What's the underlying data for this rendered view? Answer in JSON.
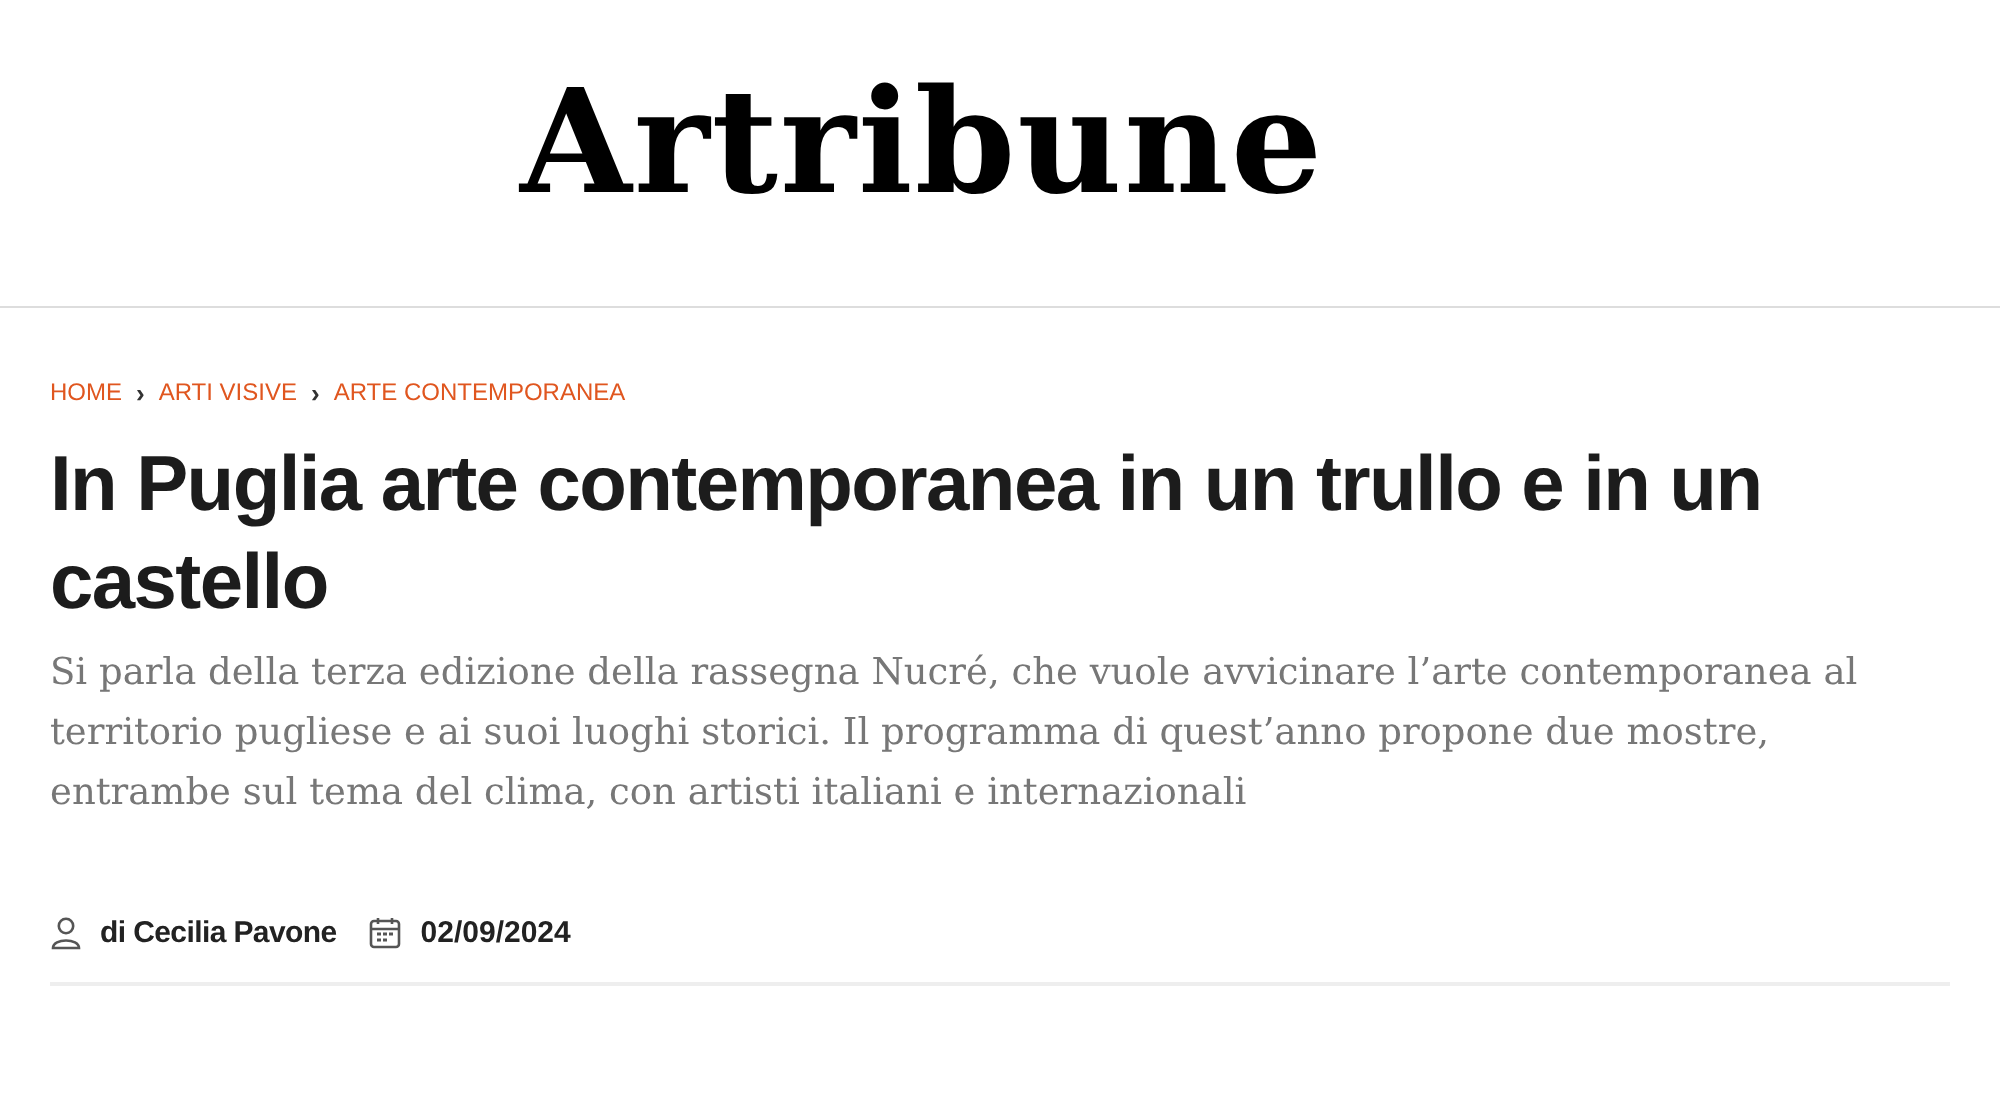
{
  "logo": "Artribune",
  "breadcrumb": [
    {
      "label": "HOME",
      "separator": "›"
    },
    {
      "label": "ARTI VISIVE",
      "separator": "›"
    },
    {
      "label": "ARTE CONTEMPORANEA"
    }
  ],
  "title": "In Puglia arte contemporanea in un trullo e in un castello",
  "subtitle": "Si parla della terza edizione della rassegna Nucré, che vuole avvicinare l’arte contemporanea al territorio pugliese e ai suoi luoghi storici. Il programma di quest’anno propone due mostre, entrambe sul tema del clima, con artisti italiani e internazionali",
  "meta": {
    "author": "di Cecilia Pavone",
    "date": "02/09/2024"
  }
}
